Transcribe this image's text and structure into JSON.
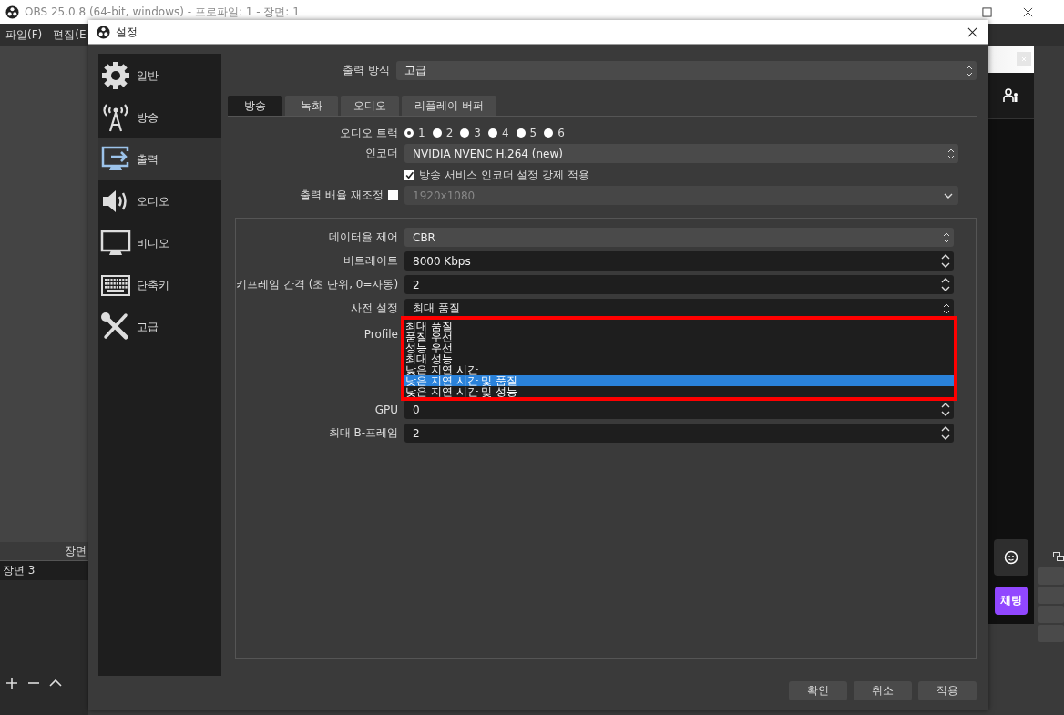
{
  "main_window": {
    "title": "OBS 25.0.8 (64-bit, windows) - 프로파일: 1 - 장면: 1",
    "menu": [
      "파일(F)",
      "편집(E"
    ]
  },
  "scenes_panel": {
    "title": "장면",
    "items": [
      "장면 3"
    ]
  },
  "chat_panel": {
    "send_button": "채팅"
  },
  "dialog": {
    "title": "설정",
    "sidebar": [
      {
        "label": "일반",
        "selected": false
      },
      {
        "label": "방송",
        "selected": false
      },
      {
        "label": "출력",
        "selected": true
      },
      {
        "label": "오디오",
        "selected": false
      },
      {
        "label": "비디오",
        "selected": false
      },
      {
        "label": "단축키",
        "selected": false
      },
      {
        "label": "고급",
        "selected": false
      }
    ],
    "output_mode": {
      "label": "출력 방식",
      "value": "고급"
    },
    "tabs": [
      {
        "label": "방송",
        "selected": true
      },
      {
        "label": "녹화",
        "selected": false
      },
      {
        "label": "오디오",
        "selected": false
      },
      {
        "label": "리플레이 버퍼",
        "selected": false
      }
    ],
    "audio_track": {
      "label": "오디오 트랙",
      "options": [
        {
          "label": "1",
          "selected": true
        },
        {
          "label": "2",
          "selected": false
        },
        {
          "label": "3",
          "selected": false
        },
        {
          "label": "4",
          "selected": false
        },
        {
          "label": "5",
          "selected": false
        },
        {
          "label": "6",
          "selected": false
        }
      ]
    },
    "encoder": {
      "label": "인코더",
      "value": "NVIDIA NVENC H.264 (new)"
    },
    "enforce_settings": {
      "label": "방송 서비스 인코더 설정 강제 적용",
      "checked": true
    },
    "rescale": {
      "label": "출력 배율 재조정",
      "checked": false,
      "value": "1920x1080",
      "disabled": true
    },
    "encoder_settings": [
      {
        "kind": "combo",
        "label": "데이터율 제어",
        "value": "CBR"
      },
      {
        "kind": "spin",
        "label": "비트레이트",
        "value": "8000 Kbps"
      },
      {
        "kind": "spin",
        "label": "키프레임 간격 (초 단위, 0=자동)",
        "value": "2"
      },
      {
        "kind": "preset",
        "label": "사전 설정",
        "value": "최대 품질"
      },
      {
        "kind": "covered",
        "label": "Profile"
      },
      {
        "kind": "spin",
        "label": "GPU",
        "value": "0"
      },
      {
        "kind": "spin",
        "label": "최대 B-프레임",
        "value": "2"
      }
    ],
    "preset_dropdown": [
      {
        "label": "최대 품질",
        "selected": false
      },
      {
        "label": "품질 우선",
        "selected": false
      },
      {
        "label": "성능 우선",
        "selected": false
      },
      {
        "label": "최대 성능",
        "selected": false
      },
      {
        "label": "낮은 지연 시간",
        "selected": false
      },
      {
        "label": "낮은 지연 시간 및 품질",
        "selected": true
      },
      {
        "label": "낮은 지연 시간 및 성능",
        "selected": false
      }
    ],
    "buttons": [
      "확인",
      "취소",
      "적용"
    ]
  }
}
